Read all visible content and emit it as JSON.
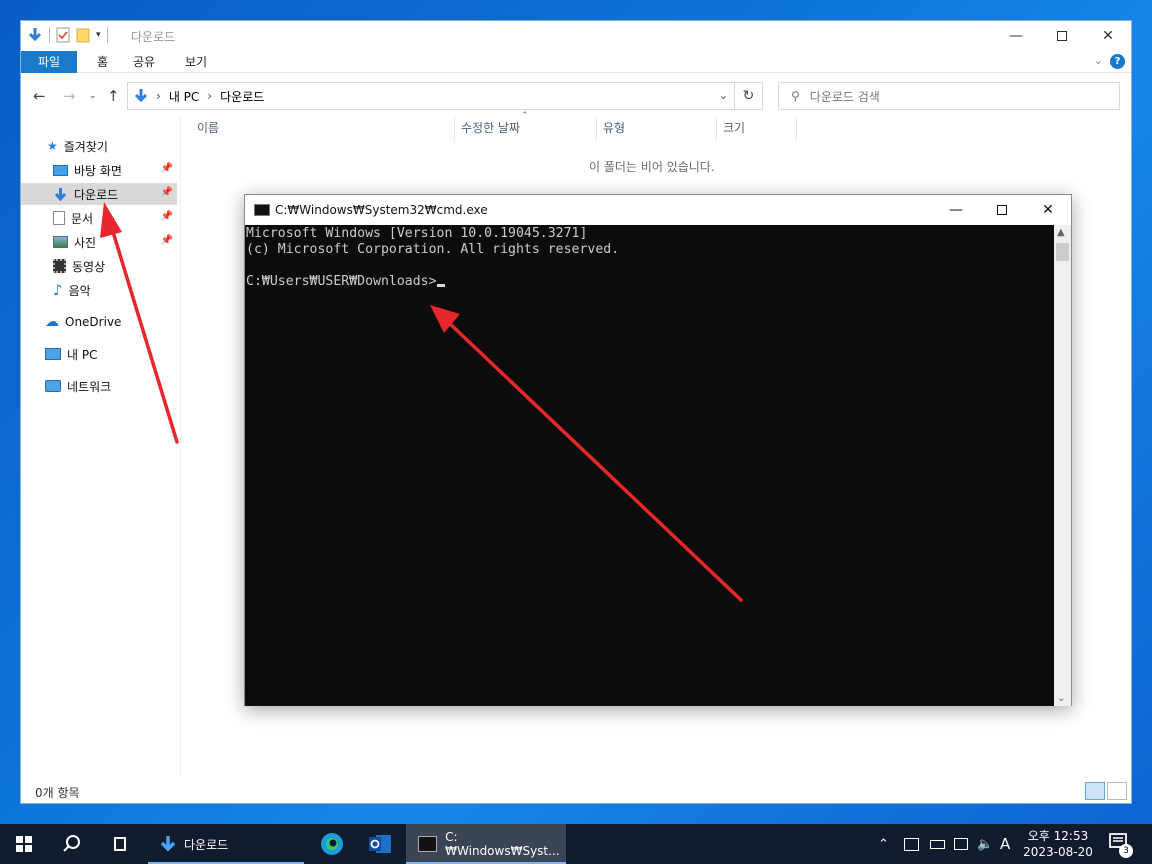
{
  "explorer": {
    "title": "다운로드",
    "ribbon_tabs": [
      "파일",
      "홈",
      "공유",
      "보기"
    ],
    "help_label": "?",
    "breadcrumb": [
      "내 PC",
      "다운로드"
    ],
    "search_placeholder": "다운로드 검색",
    "sidebar": {
      "favorites": "즐겨찾기",
      "items": [
        {
          "label": "바탕 화면",
          "icon": "desktop-icon",
          "pinned": true
        },
        {
          "label": "다운로드",
          "icon": "download-icon",
          "pinned": true,
          "selected": true
        },
        {
          "label": "문서",
          "icon": "document-icon",
          "pinned": true
        },
        {
          "label": "사진",
          "icon": "picture-icon",
          "pinned": true
        },
        {
          "label": "동영상",
          "icon": "video-icon",
          "pinned": false
        },
        {
          "label": "음악",
          "icon": "music-icon",
          "pinned": false
        }
      ],
      "onedrive": "OneDrive",
      "thispc": "내 PC",
      "network": "네트워크"
    },
    "columns": [
      "이름",
      "수정한 날짜",
      "유형",
      "크기"
    ],
    "empty_message": "이 폴더는 비어 있습니다.",
    "status_count": "0개 항목"
  },
  "cmd": {
    "title": "C:₩Windows₩System32₩cmd.exe",
    "lines": [
      "Microsoft Windows [Version 10.0.19045.3271]",
      "(c) Microsoft Corporation. All rights reserved.",
      "",
      "C:₩Users₩USER₩Downloads>"
    ]
  },
  "taskbar": {
    "apps": [
      {
        "label": "다운로드",
        "icon": "download-folder-icon"
      },
      {
        "label": "",
        "icon": "edge-icon"
      },
      {
        "label": "",
        "icon": "outlook-icon"
      },
      {
        "label": "C:₩Windows₩Syst...",
        "icon": "cmd-icon",
        "active": true
      }
    ],
    "ime": "A",
    "time": "오후 12:53",
    "date": "2023-08-20",
    "notification_count": "3"
  },
  "colors": {
    "accent": "#1979ca",
    "arrow": "#e8262b",
    "taskbar": "#101b2e",
    "console_bg": "#0c0c0c"
  }
}
